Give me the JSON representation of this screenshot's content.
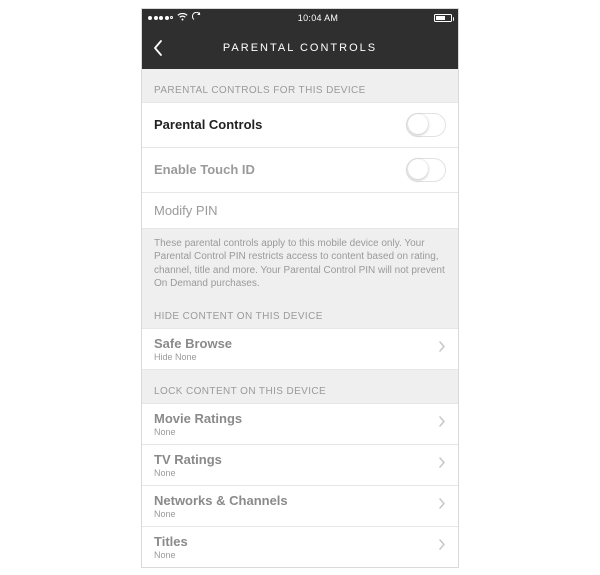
{
  "status": {
    "time": "10:04 AM",
    "wifi_icon": "wifi",
    "refresh_icon": "refresh"
  },
  "nav": {
    "title": "PARENTAL CONTROLS"
  },
  "sections": {
    "device": {
      "header": "PARENTAL CONTROLS FOR THIS DEVICE",
      "parental_controls_label": "Parental Controls",
      "enable_touch_id_label": "Enable Touch ID",
      "modify_pin_label": "Modify PIN",
      "info_text": "These parental controls apply to this mobile device only. Your Parental Control PIN restricts access to content based on rating, channel, title and more. Your Parental Control PIN will not prevent On Demand purchases."
    },
    "hide": {
      "header": "HIDE CONTENT ON THIS DEVICE",
      "safe_browse_label": "Safe Browse",
      "safe_browse_value": "Hide None"
    },
    "lock": {
      "header": "LOCK CONTENT ON THIS DEVICE",
      "movie_ratings_label": "Movie Ratings",
      "movie_ratings_value": "None",
      "tv_ratings_label": "TV Ratings",
      "tv_ratings_value": "None",
      "networks_label": "Networks & Channels",
      "networks_value": "None",
      "titles_label": "Titles",
      "titles_value": "None"
    }
  }
}
